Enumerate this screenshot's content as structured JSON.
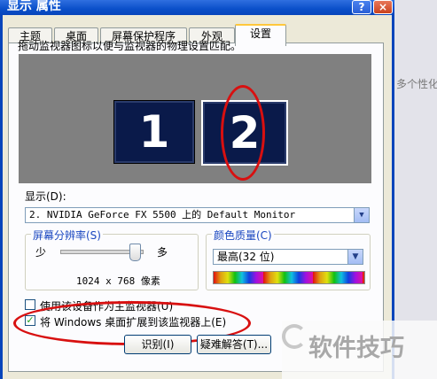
{
  "window": {
    "title": "显示 属性",
    "help_label": "?",
    "close_label": "×"
  },
  "tabs": [
    {
      "label": "主题"
    },
    {
      "label": "桌面"
    },
    {
      "label": "屏幕保护程序"
    },
    {
      "label": "外观"
    },
    {
      "label": "设置"
    }
  ],
  "active_tab": "设置",
  "settings": {
    "instruction": "拖动监视器图标以便与监视器的物理设置匹配。",
    "monitors": [
      {
        "label": "1"
      },
      {
        "label": "2"
      }
    ],
    "display_label": "显示(D):",
    "display_value": "2. NVIDIA GeForce FX 5500 上的 Default Monitor",
    "resolution": {
      "title": "屏幕分辨率(S)",
      "less_label": "少",
      "more_label": "多",
      "value": "1024 x 768 像素",
      "slider_fraction": 0.85
    },
    "color_quality": {
      "title": "颜色质量(C)",
      "value": "最高(32 位)"
    },
    "primary_checkbox": {
      "label": "使用该设备作为主监视器(U)",
      "checked": false
    },
    "extend_checkbox": {
      "label": "将 Windows 桌面扩展到该监视器上(E)",
      "checked": true
    },
    "identify_button": "识别(I)",
    "troubleshoot_button": "疑难解答(T)..."
  },
  "background_text": {
    "right_top": "多个性化"
  },
  "watermark": {
    "text": "软件技巧"
  },
  "colors": {
    "title_blue": "#0a4fc9",
    "annotation_red": "#d81010",
    "monitor_bg": "#0a1a4a"
  }
}
